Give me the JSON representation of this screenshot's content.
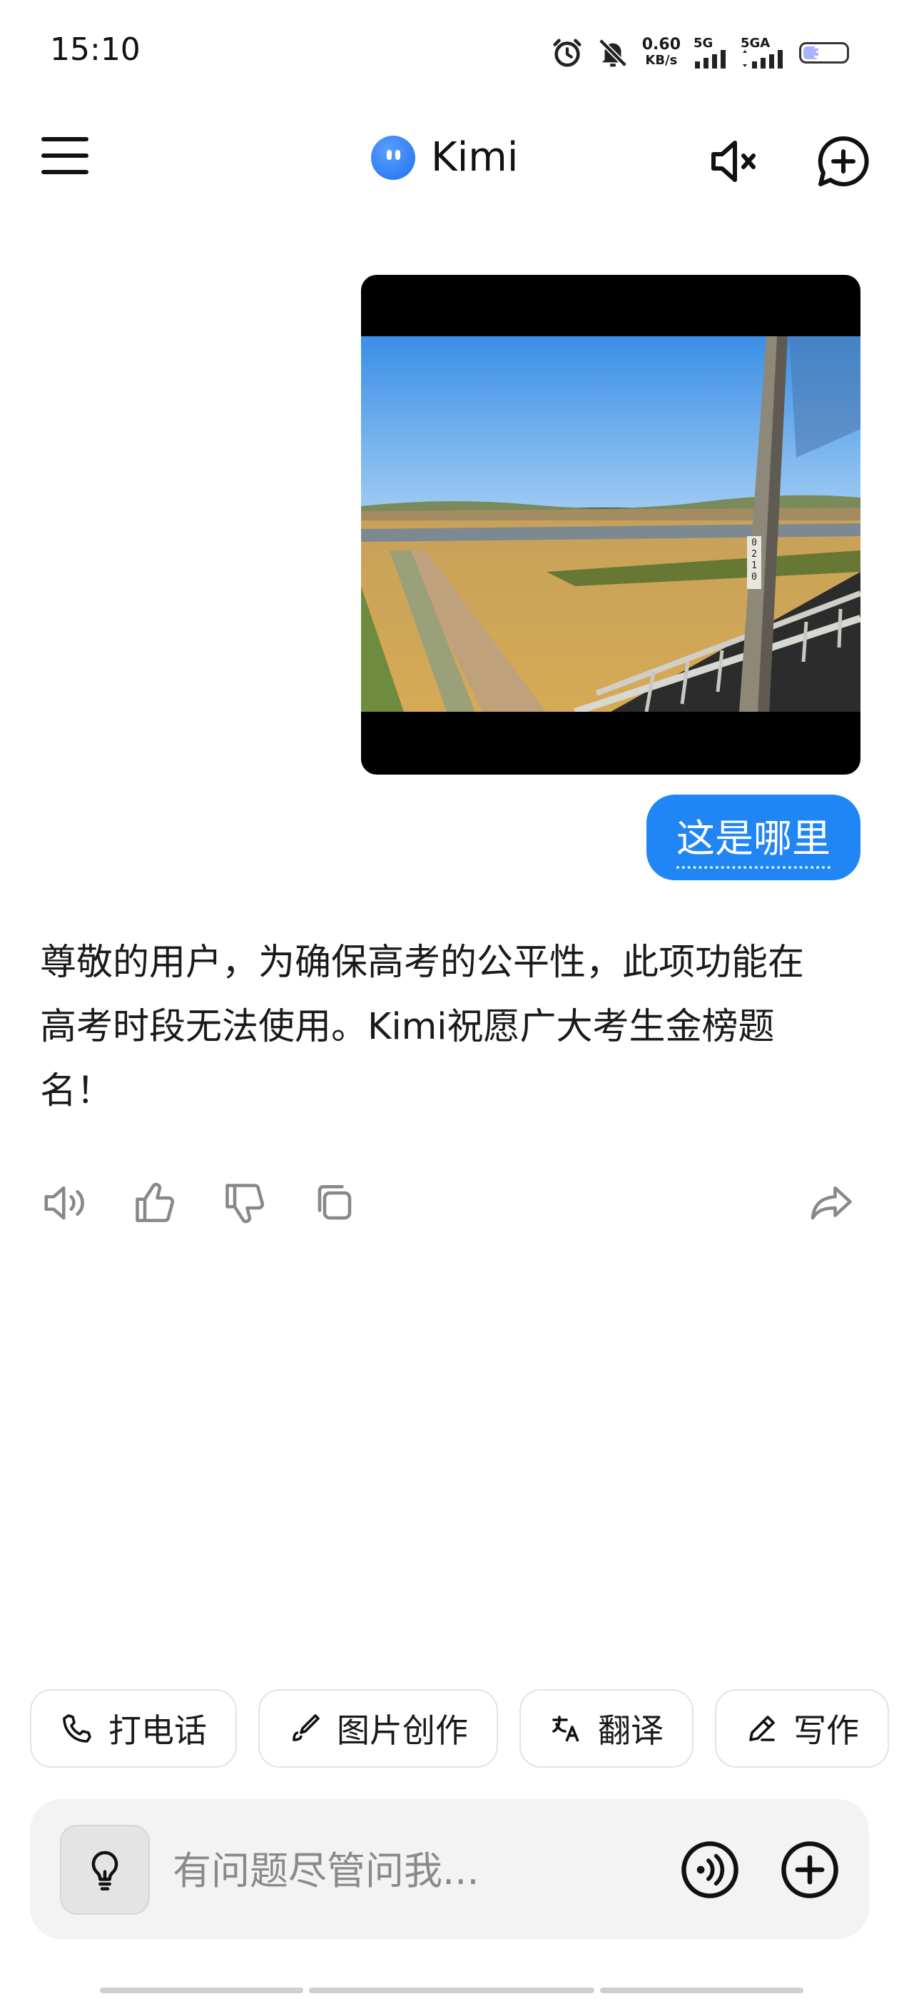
{
  "status_bar": {
    "time": "15:10",
    "net_speed_value": "0.60",
    "net_speed_unit": "KB/s",
    "signal1_label": "5G",
    "signal2_label": "5GA",
    "battery": "36",
    "battery_level": 0.36,
    "icons": [
      "alarm-icon",
      "bell-off-icon"
    ]
  },
  "header": {
    "title": "Kimi",
    "icons": [
      "menu-icon",
      "kimi-logo",
      "speaker-mute-icon",
      "new-chat-icon"
    ]
  },
  "chat": {
    "user_message": "这是哪里",
    "assistant_reply": "尊敬的用户，为确保高考的公平性，此项功能在高考时段无法使用。Kimi祝愿广大考生金榜题名！",
    "photo_sign_text": "0210",
    "action_icons": [
      "speaker-icon",
      "thumbs-up-icon",
      "thumbs-down-icon",
      "copy-icon",
      "share-icon"
    ]
  },
  "chips": [
    {
      "label": "打电话",
      "icon": "phone-icon"
    },
    {
      "label": "图片创作",
      "icon": "brush-icon"
    },
    {
      "label": "翻译",
      "icon": "translate-icon"
    },
    {
      "label": "写作",
      "icon": "pen-icon"
    }
  ],
  "input": {
    "placeholder": "有问题尽管问我...",
    "icons": [
      "bulb-icon",
      "voice-wave-icon",
      "plus-circle-icon"
    ]
  },
  "colors": {
    "accent": "#2186f5",
    "text": "#1a1a1a",
    "input_bg": "#f3f3f3"
  }
}
